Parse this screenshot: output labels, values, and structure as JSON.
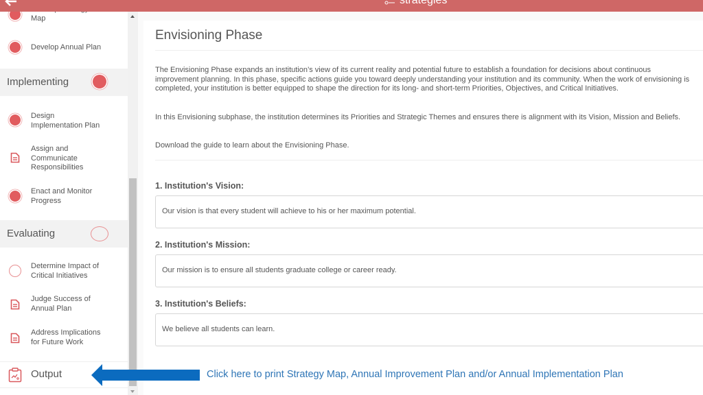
{
  "header": {
    "title": "strategies",
    "back_icon": "back-arrow-icon",
    "title_icon": "strategies-icon",
    "color": "#cf6766"
  },
  "sidebar": {
    "items_top": [
      {
        "label": "Develop Strategy\nMap",
        "icon": "filled-circle"
      },
      {
        "label": "Develop Annual Plan",
        "icon": "filled-circle"
      }
    ],
    "phases": [
      {
        "label": "Implementing",
        "status": "complete",
        "items": [
          {
            "label": "Design\nImplementation Plan",
            "icon": "filled-circle"
          },
          {
            "label": "Assign and\nCommunicate\nResponsibilities",
            "icon": "document"
          },
          {
            "label": "Enact and Monitor\nProgress",
            "icon": "filled-circle"
          }
        ]
      },
      {
        "label": "Evaluating",
        "status": "incomplete",
        "items": [
          {
            "label": "Determine Impact of\nCritical Initiatives",
            "icon": "empty-circle"
          },
          {
            "label": "Judge Success of\nAnnual Plan",
            "icon": "document"
          },
          {
            "label": "Address Implications\nfor Future Work",
            "icon": "document"
          }
        ]
      }
    ],
    "output": {
      "label": "Output",
      "icon": "clipboard-icon"
    }
  },
  "main": {
    "title": "Envisioning Phase",
    "paragraphs": [
      "The Envisioning Phase expands an institution’s view of its current reality and potential future to establish a foundation for decisions about continuous improvement planning. In this phase, specific actions guide you toward deeply understanding your institution and its community. When the work of envisioning is completed, your institution is better equipped to shape the direction for its long- and short-term Priorities, Objectives, and Critical Initiatives.",
      "In this Envisioning subphase, the institution determines its Priorities and Strategic Themes and ensures there is alignment with its Vision, Mission and Beliefs.",
      "Download the guide to learn about the Envisioning Phase."
    ],
    "questions": [
      {
        "label": "1. Institution's Vision:",
        "value": "Our vision is that every student will achieve to his or her maximum potential."
      },
      {
        "label": "2. Institution's Mission:",
        "value": "Our mission is to ensure all students graduate college or career ready."
      },
      {
        "label": "3. Institution's Beliefs:",
        "value": "We believe all students can learn."
      }
    ]
  },
  "annotation": {
    "text": "Click here to print Strategy Map,  Annual Improvement Plan and/or Annual Implementation Plan",
    "arrow_color": "#0b6bbf",
    "text_color": "#2e75b6"
  }
}
